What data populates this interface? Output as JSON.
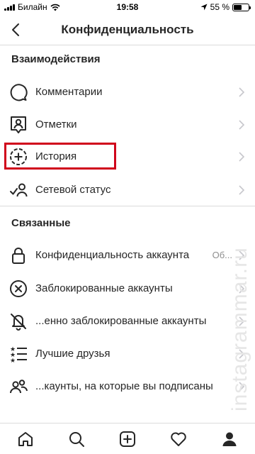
{
  "status_bar": {
    "carrier": "Билайн",
    "time": "19:58",
    "battery": "55 %",
    "battery_level": 0.55
  },
  "header": {
    "title": "Конфиденциальность"
  },
  "sections": {
    "interactions": {
      "title": "Взаимодействия",
      "items": [
        {
          "label": "Комментарии",
          "icon": "comment-icon"
        },
        {
          "label": "Отметки",
          "icon": "tag-person-icon"
        },
        {
          "label": "История",
          "icon": "story-add-icon"
        },
        {
          "label": "Сетевой статус",
          "icon": "activity-status-icon"
        }
      ]
    },
    "connections": {
      "title": "Связанные",
      "items": [
        {
          "label": "Конфиденциальность аккаунта",
          "value": "Об...",
          "icon": "lock-icon"
        },
        {
          "label": "Заблокированные аккаунты",
          "icon": "blocked-icon"
        },
        {
          "label": "...енно заблокированные аккаунты",
          "icon": "muted-bell-icon"
        },
        {
          "label": "Лучшие друзья",
          "icon": "close-friends-icon"
        },
        {
          "label": "...каунты, на которые вы подписаны",
          "icon": "following-icon"
        }
      ]
    }
  },
  "watermark": "instagrammar.ru",
  "tab_bar": [
    "home-icon",
    "search-icon",
    "new-post-icon",
    "activity-heart-icon",
    "profile-icon"
  ],
  "colors": {
    "text": "#262626",
    "secondary": "#8e8e8e",
    "divider": "#dbdbdb",
    "highlight": "#d0021b"
  }
}
